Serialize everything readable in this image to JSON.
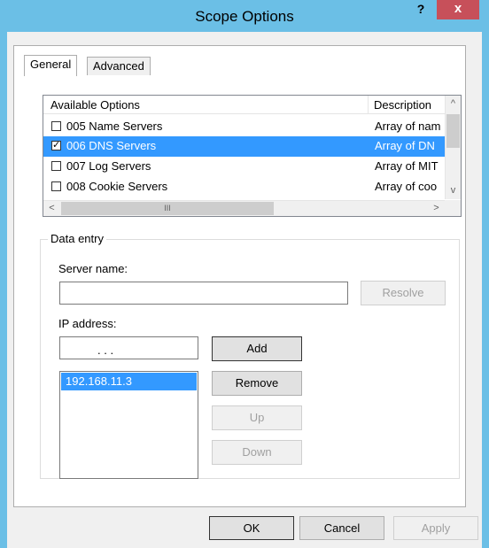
{
  "window": {
    "title": "Scope Options",
    "help_label": "?",
    "close_label": "x"
  },
  "tabs": [
    {
      "label": "General"
    },
    {
      "label": "Advanced"
    }
  ],
  "options_list": {
    "headers": {
      "name": "Available Options",
      "description": "Description"
    },
    "rows": [
      {
        "checked": false,
        "name": "005 Name Servers",
        "description": "Array of nam",
        "selected": false
      },
      {
        "checked": true,
        "name": "006 DNS Servers",
        "description": "Array of DN",
        "selected": true
      },
      {
        "checked": false,
        "name": "007 Log Servers",
        "description": "Array of MIT",
        "selected": false
      },
      {
        "checked": false,
        "name": "008 Cookie Servers",
        "description": "Array of coo",
        "selected": false
      }
    ],
    "scroll_up": "^",
    "scroll_down": "v",
    "scroll_left": "<",
    "scroll_right": ">",
    "hthumb_grip": "III"
  },
  "data_entry": {
    "group_label": "Data entry",
    "server_name_label": "Server name:",
    "server_name_value": "",
    "resolve_label": "Resolve",
    "ip_label": "IP address:",
    "ip_dots": ".   .   .",
    "add_label": "Add",
    "remove_label": "Remove",
    "up_label": "Up",
    "down_label": "Down",
    "ip_list": [
      "192.168.11.3"
    ]
  },
  "footer": {
    "ok": "OK",
    "cancel": "Cancel",
    "apply": "Apply"
  },
  "colors": {
    "selection": "#3399ff",
    "titlebar": "#6bbfe6",
    "close": "#c7505a"
  }
}
